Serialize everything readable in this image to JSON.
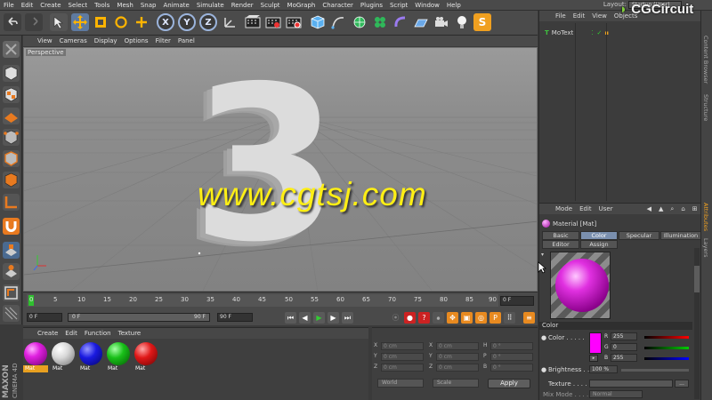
{
  "menubar": {
    "items": [
      "File",
      "Edit",
      "Create",
      "Select",
      "Tools",
      "Mesh",
      "Snap",
      "Animate",
      "Simulate",
      "Render",
      "Sculpt",
      "MoGraph",
      "Character",
      "Plugins",
      "Script",
      "Window",
      "Help"
    ],
    "layout_label": "Layout:",
    "layout_value": "Startup (User)"
  },
  "watermark_brand": "CGCircuit",
  "watermark_url": "www.cgtsj.com",
  "toolbar": {
    "icons": [
      "undo-icon",
      "redo-icon",
      "live-select-icon",
      "move-icon",
      "scale-icon",
      "rotate-icon",
      "add-icon",
      "x-axis-icon",
      "y-axis-icon",
      "z-axis-icon",
      "coord-system-icon",
      "render-view-icon",
      "render-picture-viewer-icon",
      "render-settings-icon",
      "cube-icon",
      "pen-icon",
      "subdivision-icon",
      "array-icon",
      "deformer-icon",
      "floor-icon",
      "camera-icon",
      "light-icon",
      "python-icon"
    ],
    "axis_x": "X",
    "axis_y": "Y",
    "axis_z": "Z",
    "python": "S"
  },
  "viewport": {
    "menu": [
      "View",
      "Cameras",
      "Display",
      "Options",
      "Filter",
      "Panel"
    ],
    "name": "Perspective",
    "text_3d": "3"
  },
  "timeline": {
    "ticks": [
      "0",
      "5",
      "10",
      "15",
      "20",
      "25",
      "30",
      "35",
      "40",
      "45",
      "50",
      "55",
      "60",
      "65",
      "70",
      "75",
      "80",
      "85",
      "90"
    ],
    "frame_end": "0 F",
    "start_field": "0 F",
    "slider_start": "0 F",
    "slider_end": "90 F",
    "end_field": "90 F"
  },
  "material_manager": {
    "menu": [
      "Create",
      "Edit",
      "Function",
      "Texture"
    ],
    "materials": [
      {
        "label": "Mat",
        "color": "#e020e0",
        "selected": true
      },
      {
        "label": "Mat",
        "color": "#e8e8e8",
        "selected": false
      },
      {
        "label": "Mat",
        "color": "#1a1ae0",
        "selected": false
      },
      {
        "label": "Mat",
        "color": "#18c018",
        "selected": false
      },
      {
        "label": "Mat",
        "color": "#e01818",
        "selected": false
      }
    ]
  },
  "coordinates": {
    "rows": [
      {
        "a": "X",
        "av": "0 cm",
        "b": "X",
        "bv": "0 cm",
        "c": "H",
        "cv": "0 °"
      },
      {
        "a": "Y",
        "av": "0 cm",
        "b": "Y",
        "bv": "0 cm",
        "c": "P",
        "cv": "0 °"
      },
      {
        "a": "Z",
        "av": "0 cm",
        "b": "Z",
        "bv": "0 cm",
        "c": "B",
        "cv": "0 °"
      }
    ],
    "space": "World",
    "mode": "Scale",
    "apply": "Apply"
  },
  "maxon": {
    "brand": "MAXON",
    "product": "CINEMA 4D"
  },
  "object_manager": {
    "menu": [
      "File",
      "Edit",
      "View",
      "Objects"
    ],
    "object_name": "MoText"
  },
  "attribute_manager": {
    "menu": [
      "Mode",
      "Edit",
      "User"
    ],
    "title": "Material [Mat]",
    "tabs": [
      "Basic",
      "Color",
      "Specular",
      "Illumination",
      "Editor",
      "Assign"
    ],
    "active_tab": "Color",
    "section": "Color",
    "color_label": "Color . . . . .",
    "r_label": "R",
    "r_value": "255",
    "g_label": "G",
    "g_value": "0",
    "b_label": "B",
    "b_value": "255",
    "brightness_label": "Brightness . . .",
    "brightness_value": "100 %",
    "texture_label": "Texture . . . . .",
    "mix_label": "Mix Mode . . . .",
    "mix_value": "Normal",
    "color_value": "#ff00ff"
  },
  "right_strip": [
    "Content Browser",
    "Structure",
    "Attributes",
    "Layers"
  ]
}
